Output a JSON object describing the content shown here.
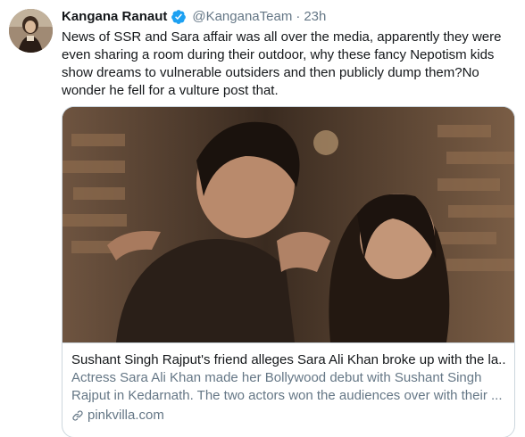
{
  "tweet": {
    "author_name": "Kangana Ranaut",
    "handle": "@KanganaTeam",
    "separator": "·",
    "time": "23h",
    "text": "News of SSR and Sara affair was all over the media, apparently they were even sharing a room during their outdoor, why these fancy Nepotism kids show dreams to vulnerable outsiders and then publicly dump them?No wonder he fell for a vulture post that."
  },
  "card": {
    "title": "Sushant Singh Rajput's friend alleges Sara Ali Khan broke up with the la...",
    "description": "Actress Sara Ali Khan made her Bollywood debut with Sushant Singh Rajput in Kedarnath. The two actors won the audiences over with their ...",
    "domain": "pinkvilla.com"
  },
  "colors": {
    "text_primary": "#14171a",
    "text_secondary": "#657786",
    "border": "#ccd6dd",
    "verified_blue": "#1da1f2"
  },
  "icons": {
    "verified": "verified-badge-icon",
    "link": "link-icon"
  }
}
